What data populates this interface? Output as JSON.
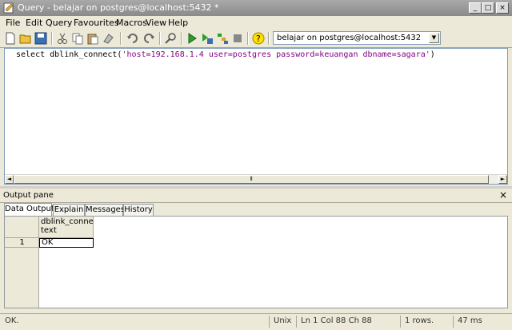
{
  "window": {
    "title": "Query - belajar on postgres@localhost:5432 *",
    "min_glyph": "_",
    "max_glyph": "□",
    "close_glyph": "×"
  },
  "menu": [
    "File",
    "Edit",
    "Query",
    "Favourites",
    "Macros",
    "View",
    "Help"
  ],
  "toolbar": {
    "connection": "belajar on postgres@localhost:5432",
    "dropdown_glyph": "▼"
  },
  "editor": {
    "code_prefix": "select dblink_connect(",
    "code_string": "'host=192.168.1.4 user=postgres password=keuangan dbname=sagara'",
    "code_suffix": ")",
    "scroll_left": "◄",
    "scroll_right": "►",
    "thumb_grip": "⦀"
  },
  "output_pane": {
    "title": "Output pane",
    "close_glyph": "×",
    "tabs": [
      "Data Output",
      "Explain",
      "Messages",
      "History"
    ],
    "column_header": "dblink_conne\ntext",
    "rows": [
      {
        "num": "1",
        "value": "OK"
      }
    ]
  },
  "status": {
    "message": "OK.",
    "line_endings": "Unix",
    "position": "Ln 1 Col 88 Ch 88",
    "rows": "1 rows.",
    "time": "47 ms"
  },
  "colors": {
    "titlebar": "#999999",
    "string_literal": "#7f007f",
    "panel_bg": "#ece9d8"
  }
}
